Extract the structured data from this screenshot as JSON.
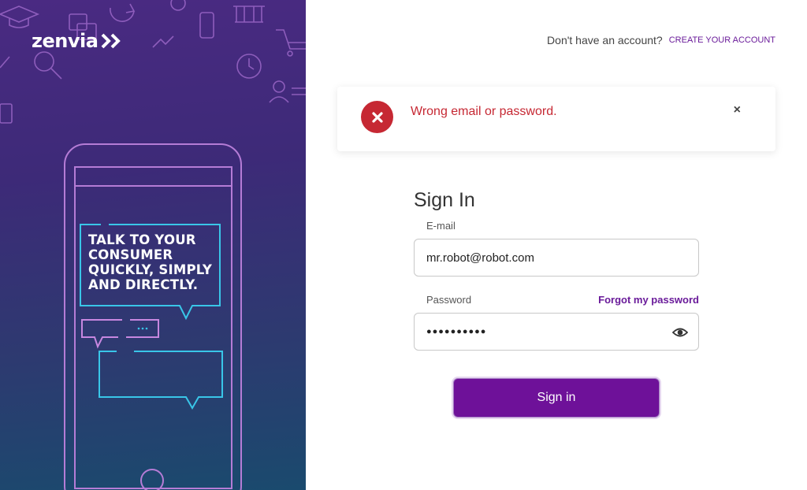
{
  "brand": {
    "name": "zenvia",
    "accent": "#6a1b9a",
    "error": "#c62833"
  },
  "hero": {
    "message": "TALK TO YOUR CONSUMER QUICKLY, SIMPLY AND DIRECTLY."
  },
  "header": {
    "question": "Don't have an account?",
    "create_account": "CREATE YOUR ACCOUNT"
  },
  "alert": {
    "message": "Wrong email or password.",
    "close": "×",
    "icon": "error-x-icon"
  },
  "form": {
    "title": "Sign In",
    "email_label": "E-mail",
    "email_value": "mr.robot@robot.com",
    "password_label": "Password",
    "forgot_label": "Forgot my password",
    "password_mask": "●●●●●●●●●●",
    "toggle_icon": "eye-icon",
    "submit_label": "Sign in"
  }
}
